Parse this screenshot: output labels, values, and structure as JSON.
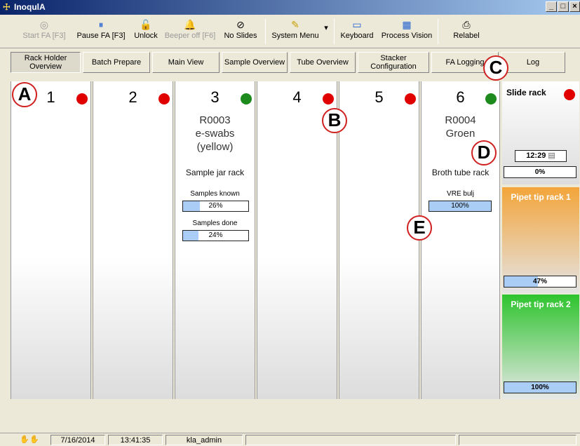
{
  "window": {
    "title": "InoqulA",
    "controls": [
      "_",
      "□",
      "×"
    ]
  },
  "toolbar": {
    "buttons": [
      {
        "label": "Start FA [F3]",
        "icon": "start-icon",
        "glyph": "◎",
        "enabled": false
      },
      {
        "label": "Pause FA [F3]",
        "icon": "pause-icon",
        "glyph": "⏸",
        "enabled": true
      },
      {
        "label": "Unlock",
        "icon": "unlock-icon",
        "glyph": "🔓",
        "enabled": true
      },
      {
        "label": "Beeper off [F6]",
        "icon": "beeper-icon",
        "glyph": "🔔",
        "enabled": false
      },
      {
        "label": "No Slides",
        "icon": "no-slides-icon",
        "glyph": "⊘",
        "enabled": true
      },
      {
        "label": "System Menu",
        "icon": "system-menu-icon",
        "glyph": "✎",
        "enabled": true
      },
      {
        "label": "Keyboard",
        "icon": "keyboard-icon",
        "glyph": "▭",
        "enabled": true
      },
      {
        "label": "Process Vision",
        "icon": "process-vision-icon",
        "glyph": "▦",
        "enabled": true
      },
      {
        "label": "Relabel",
        "icon": "printer-icon",
        "glyph": "⎙",
        "enabled": true
      }
    ],
    "system_menu_arrow": "▾"
  },
  "tabs": [
    {
      "label": "Rack Holder Overview",
      "active": true
    },
    {
      "label": "Batch Prepare",
      "active": false
    },
    {
      "label": "Main View",
      "active": false
    },
    {
      "label": "Sample Overview",
      "active": false
    },
    {
      "label": "Tube Overview",
      "active": false
    },
    {
      "label": "Stacker Configuration",
      "active": false
    },
    {
      "label": "FA Logging",
      "active": false
    },
    {
      "label": "Log",
      "active": false
    }
  ],
  "slots": [
    {
      "number": "1",
      "status": "red"
    },
    {
      "number": "2",
      "status": "red"
    },
    {
      "number": "3",
      "status": "green",
      "rack_id": "R0003",
      "line2": "e-swabs",
      "line3": "(yellow)",
      "rack_type": "Sample jar rack",
      "bars": [
        {
          "label": "Samples known",
          "value": 26,
          "text": "26%"
        },
        {
          "label": "Samples done",
          "value": 24,
          "text": "24%"
        }
      ]
    },
    {
      "number": "4",
      "status": "red"
    },
    {
      "number": "5",
      "status": "red"
    },
    {
      "number": "6",
      "status": "green",
      "rack_id": "R0004",
      "line2": "Groen",
      "rack_type": "Broth tube rack",
      "bars": [
        {
          "label": "VRE bulj",
          "value": 100,
          "text": "100%"
        }
      ]
    }
  ],
  "side": {
    "slide_rack": {
      "title": "Slide rack",
      "status": "red",
      "time": "12:29",
      "progress": 0,
      "progress_text": "0%"
    },
    "pipet1": {
      "title": "Pipet tip rack 1",
      "progress": 47,
      "progress_text": "47%"
    },
    "pipet2": {
      "title": "Pipet tip rack 2",
      "progress": 100,
      "progress_text": "100%"
    }
  },
  "callouts": [
    "A",
    "B",
    "C",
    "D",
    "E"
  ],
  "statusbar": {
    "date": "7/16/2014",
    "time": "13:41:35",
    "user": "kla_admin"
  },
  "colors": {
    "red": "#e00000",
    "green": "#1c8a1c",
    "orange": "#f3a53a",
    "lime": "#2ec42e",
    "bar_fill": "#a9cdf5"
  }
}
